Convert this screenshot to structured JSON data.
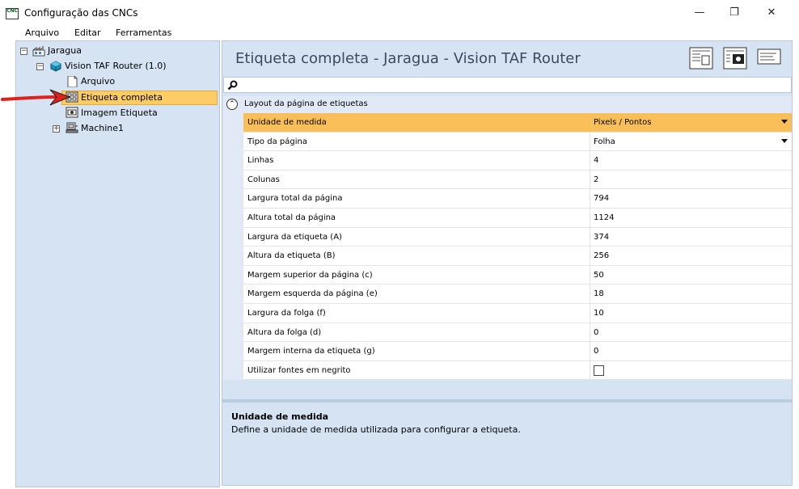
{
  "window": {
    "title": "Configuração das CNCs",
    "icon_text": "CNC",
    "minimize_glyph": "—",
    "maximize_glyph": "❐",
    "close_glyph": "✕"
  },
  "menu": [
    "Arquivo",
    "Editar",
    "Ferramentas"
  ],
  "tree": {
    "root": "Jaragua",
    "device": "Vision TAF Router (1.0)",
    "children": [
      "Arquivo",
      "Etiqueta completa",
      "Imagem Etiqueta",
      "Machine1"
    ],
    "selected": "Etiqueta completa",
    "expand_glyphs": {
      "expanded": "−",
      "collapsed": "+"
    }
  },
  "panel": {
    "title": "Etiqueta completa - Jaragua - Vision TAF Router"
  },
  "properties": {
    "category": "Layout da página de etiquetas",
    "category_toggle": "⌃",
    "rows": [
      {
        "name": "Unidade de medida",
        "value": "Pixels / Pontos"
      },
      {
        "name": "Tipo da página",
        "value": "Folha"
      },
      {
        "name": "Linhas",
        "value": "4"
      },
      {
        "name": "Colunas",
        "value": "2"
      },
      {
        "name": "Largura total da página",
        "value": "794"
      },
      {
        "name": "Altura total da página",
        "value": "1124"
      },
      {
        "name": "Largura da etiqueta (A)",
        "value": "374"
      },
      {
        "name": "Altura da etiqueta (B)",
        "value": "256"
      },
      {
        "name": "Margem superior da página (c)",
        "value": "50"
      },
      {
        "name": "Margem esquerda da página (e)",
        "value": "18"
      },
      {
        "name": "Largura da folga (f)",
        "value": "10"
      },
      {
        "name": "Altura da folga (d)",
        "value": "0"
      },
      {
        "name": "Margem interna da etiqueta (g)",
        "value": "0"
      },
      {
        "name": "Utilizar fontes em negrito",
        "value": ""
      }
    ]
  },
  "description": {
    "title": "Unidade de medida",
    "text": "Define a unidade de medida utilizada para configurar a etiqueta."
  },
  "colors": {
    "panel_bg": "#d6e3f3",
    "selected": "#fccc66",
    "selected_row": "#fbbf5a",
    "arrow": "#e0201c"
  }
}
